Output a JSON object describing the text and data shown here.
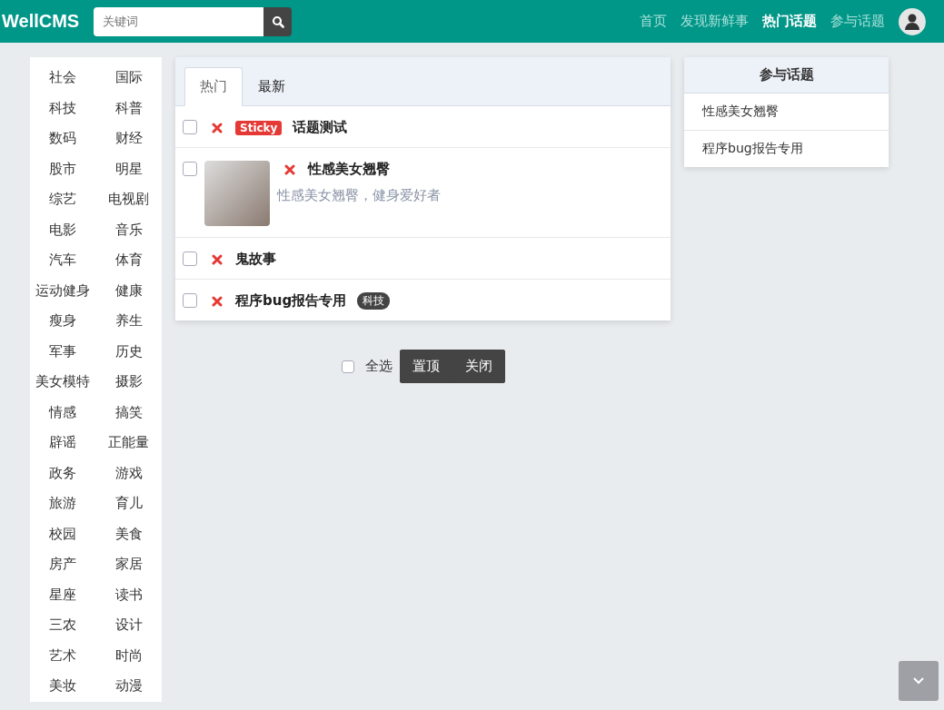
{
  "header": {
    "logo": "WellCMS",
    "search": {
      "placeholder": "关键词"
    },
    "nav": [
      {
        "label": "首页",
        "selected": false
      },
      {
        "label": "发现新鲜事",
        "selected": false
      },
      {
        "label": "热门话题",
        "selected": true
      },
      {
        "label": "参与话题",
        "selected": false
      }
    ]
  },
  "categories": [
    "社会",
    "国际",
    "科技",
    "科普",
    "数码",
    "财经",
    "股市",
    "明星",
    "综艺",
    "电视剧",
    "电影",
    "音乐",
    "汽车",
    "体育",
    "运动健身",
    "健康",
    "瘦身",
    "养生",
    "军事",
    "历史",
    "美女模特",
    "摄影",
    "情感",
    "搞笑",
    "辟谣",
    "正能量",
    "政务",
    "游戏",
    "旅游",
    "育儿",
    "校园",
    "美食",
    "房产",
    "家居",
    "星座",
    "读书",
    "三农",
    "设计",
    "艺术",
    "时尚",
    "美妆",
    "动漫"
  ],
  "tabs": [
    {
      "label": "热门",
      "selected": true
    },
    {
      "label": "最新",
      "selected": false
    }
  ],
  "topics": [
    {
      "title": "话题测试",
      "checked": false,
      "badge": "Sticky"
    },
    {
      "title": "性感美女翘臀",
      "checked": false,
      "thumbnail": true,
      "description": "性感美女翘臀，健身爱好者"
    },
    {
      "title": "鬼故事",
      "checked": false
    },
    {
      "title": "程序bug报告专用",
      "checked": false,
      "tag": "科技"
    }
  ],
  "bulk_actions": {
    "select_all": {
      "label": "全选",
      "checked": false
    },
    "buttons": [
      "置顶",
      "关闭"
    ]
  },
  "joined_topics": {
    "title": "参与话题",
    "items": [
      "性感美女翘臀",
      "程序bug报告专用"
    ]
  }
}
